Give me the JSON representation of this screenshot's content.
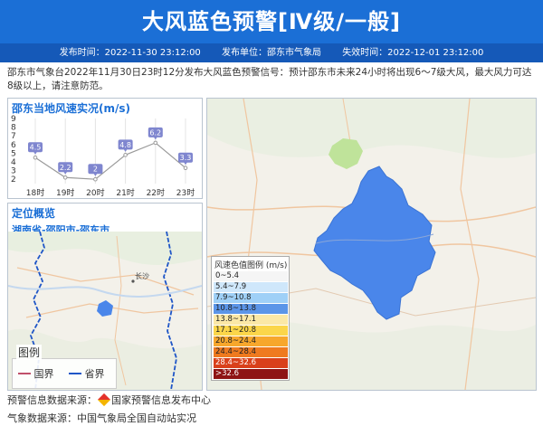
{
  "header": {
    "title": "大风蓝色预警[Ⅳ级/一般]",
    "publish_time": "发布时间：2022-11-30 23:12:00",
    "publisher": "发布单位：邵东市气象局",
    "expire_time": "失效时间：2022-12-01 23:12:00"
  },
  "description": "邵东市气象台2022年11月30日23时12分发布大风蓝色预警信号：预计邵东市未来24小时将出现6～7级大风，最大风力可达8级以上，请注意防范。",
  "wind_chart": {
    "title": "邵东当地风速实况(m/s)"
  },
  "chart_data": {
    "type": "line",
    "title": "邵东当地风速实况(m/s)",
    "categories": [
      "18时",
      "19时",
      "20时",
      "21时",
      "22时",
      "23时"
    ],
    "values": [
      4.5,
      2.2,
      2,
      4.8,
      6.2,
      3.3
    ],
    "value_labels": [
      "4.5",
      "2.2",
      "2",
      "4.8",
      "6.2",
      "3.3"
    ],
    "yticks": [
      "9",
      "8",
      "7",
      "6",
      "5",
      "4",
      "3",
      "2"
    ],
    "ylim": [
      1.5,
      9
    ],
    "grid": false,
    "colors": {
      "line": "#9a9a9a",
      "label_bg": "#7f86cf"
    }
  },
  "location": {
    "title": "定位概览",
    "region": "湖南省-邵阳市-邵东市",
    "city_label": "长沙",
    "legend_title": "图例",
    "legend_items": [
      {
        "label": "国界",
        "color": "#c0506a"
      },
      {
        "label": "省界",
        "color": "#1f56c7"
      }
    ]
  },
  "map_legend": {
    "title": "风速色值图例 (m/s)",
    "items": [
      {
        "label": "0~5.4",
        "color": "#f5f5f5"
      },
      {
        "label": "5.4~7.9",
        "color": "#cfe7fb"
      },
      {
        "label": "7.9~10.8",
        "color": "#9fd0f7"
      },
      {
        "label": "10.8~13.8",
        "color": "#5b95e8"
      },
      {
        "label": "13.8~17.1",
        "color": "#fbe8a6"
      },
      {
        "label": "17.1~20.8",
        "color": "#fbd64a"
      },
      {
        "label": "20.8~24.4",
        "color": "#f7a72c"
      },
      {
        "label": "24.4~28.4",
        "color": "#ef7a1f"
      },
      {
        "label": "28.4~32.6",
        "color": "#d9401b"
      },
      {
        "label": ">32.6",
        "color": "#8e1414"
      }
    ]
  },
  "footer": {
    "warning_source_label": "预警信息数据来源：",
    "warning_source": "国家预警信息发布中心",
    "weather_source": "气象数据来源：中国气象局全国自动站实况"
  },
  "colors": {
    "banner": "#1b6fd6",
    "meta_bar": "#1559b8",
    "warning_area": "#4a86ea"
  }
}
